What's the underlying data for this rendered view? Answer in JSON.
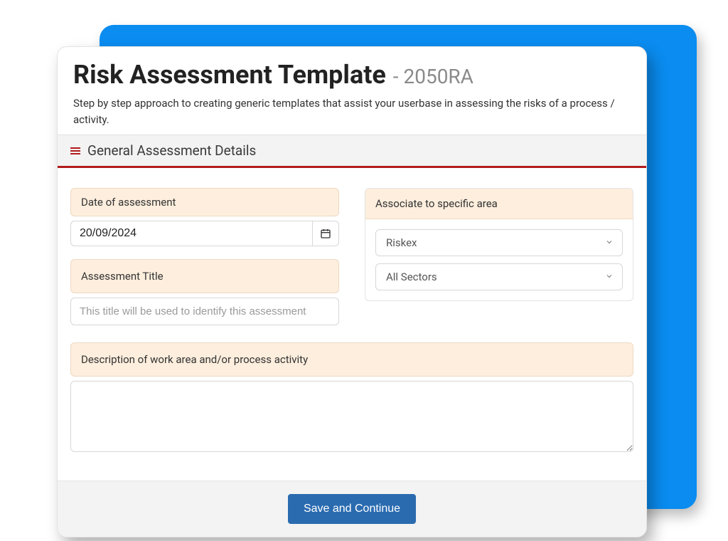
{
  "header": {
    "title": "Risk Assessment Template",
    "suffix": "- 2050RA",
    "subtitle": "Step by step approach to creating generic templates that assist your userbase in assessing the risks of a process / activity."
  },
  "section": {
    "title": "General Assessment Details"
  },
  "fields": {
    "date_label": "Date of assessment",
    "date_value": "20/09/2024",
    "title_label": "Assessment Title",
    "title_placeholder": "This title will be used to identify this assessment",
    "associate_label": "Associate to specific area",
    "select1": "Riskex",
    "select2": "All Sectors",
    "desc_label": "Description of work area and/or process activity",
    "desc_value": ""
  },
  "actions": {
    "save_label": "Save and Continue"
  }
}
